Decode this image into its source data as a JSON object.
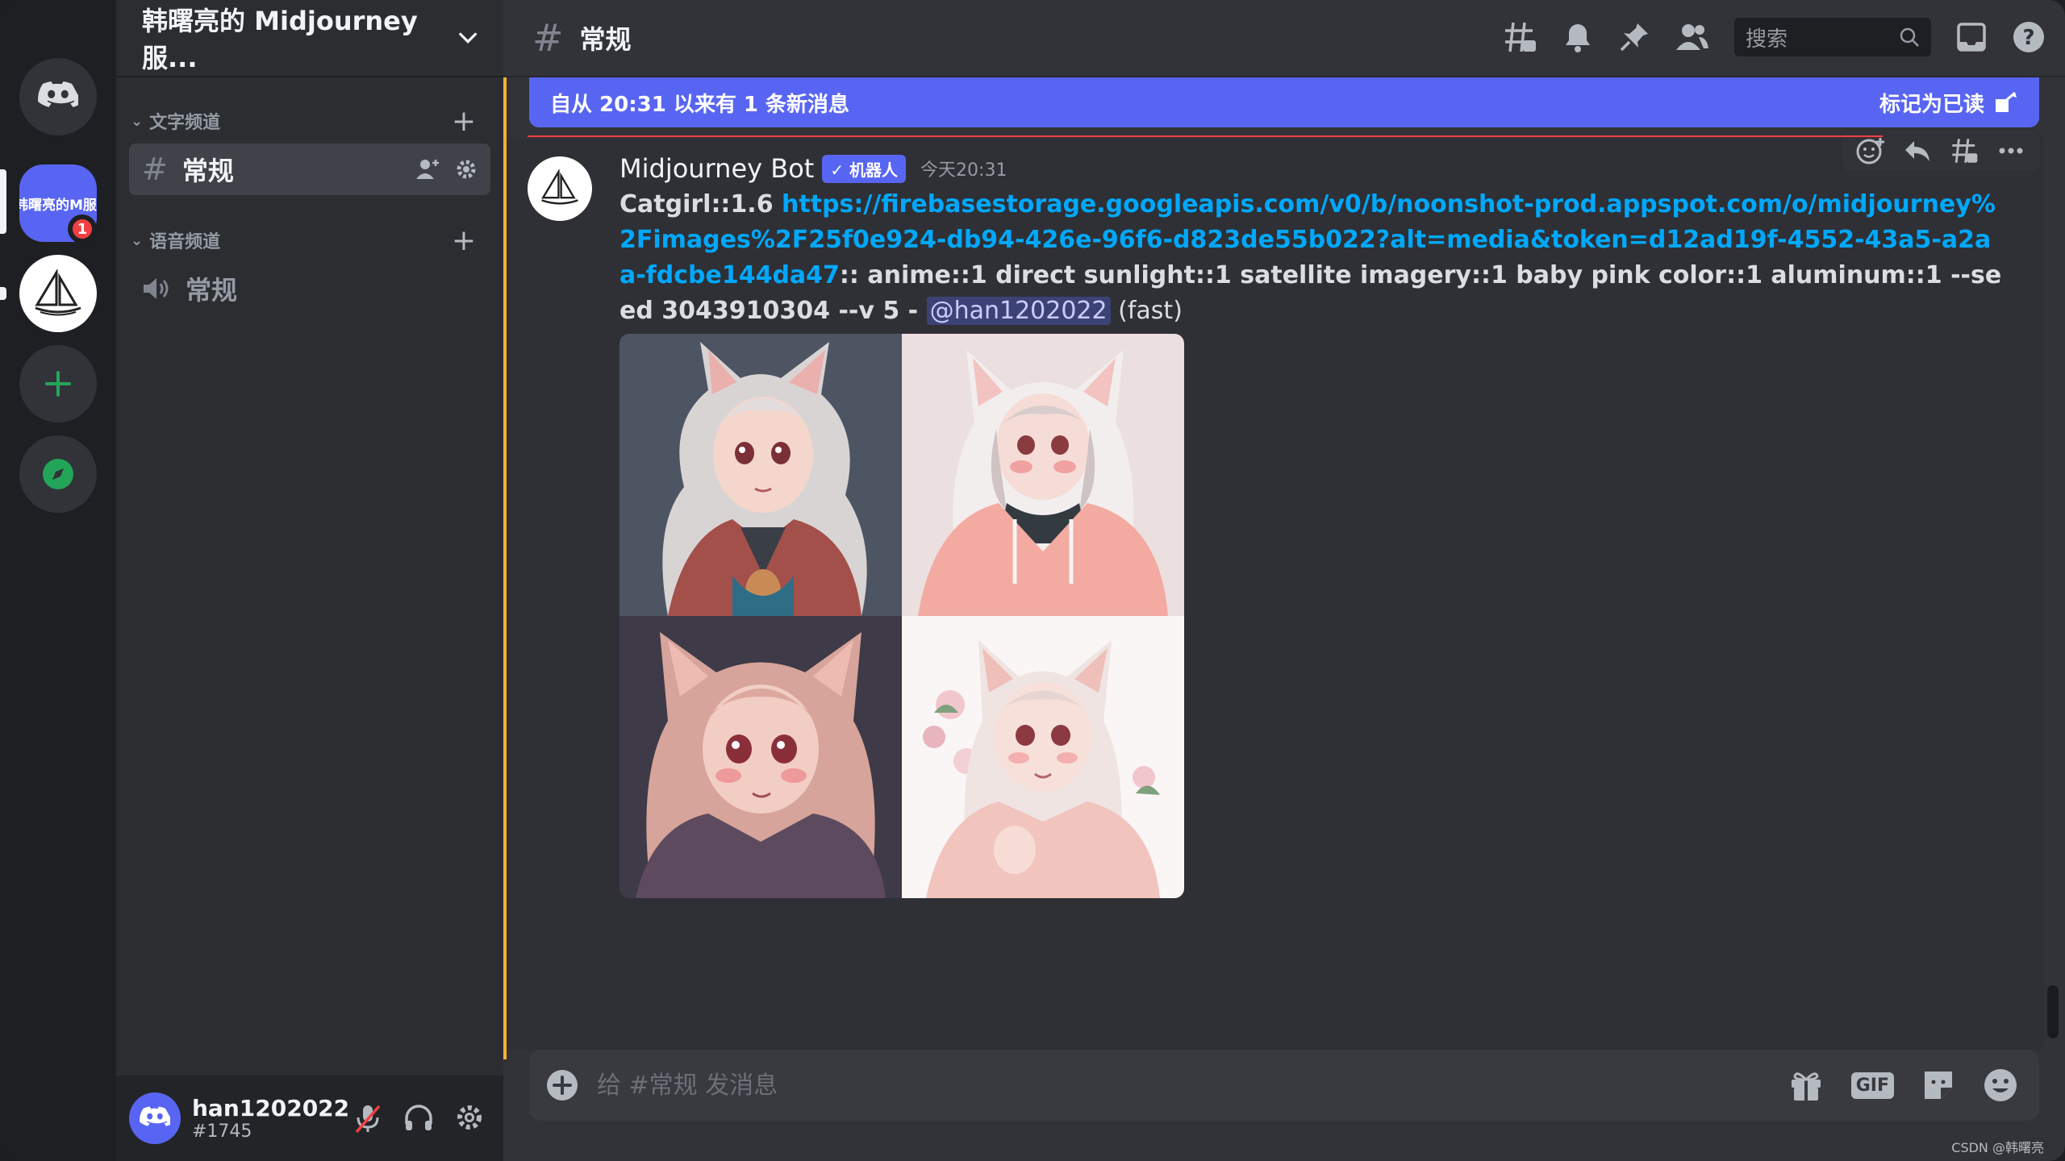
{
  "rail": {
    "server1_label": "韩曙亮的M服务",
    "server1_badge": "1"
  },
  "sidebar": {
    "guild_title": "韩曙亮的 Midjourney 服...",
    "text_category": "文字频道",
    "voice_category": "语音频道",
    "text_channel": "常规",
    "voice_channel": "常规"
  },
  "user": {
    "name": "han1202022",
    "tag": "#1745"
  },
  "topbar": {
    "channel_name": "常规",
    "search_placeholder": "搜索"
  },
  "new_messages": {
    "text": "自从 20:31 以来有 1 条新消息",
    "mark_read": "标记为已读"
  },
  "message": {
    "author": "Midjourney Bot",
    "bot_tag": "✓ 机器人",
    "time": "今天20:31",
    "prompt_prefix": "Catgirl::1.6 ",
    "link": "https://firebasestorage.googleapis.com/v0/b/noonshot-prod.appspot.com/o/midjourney%2Fimages%2F25f0e924-db94-426e-96f6-d823de55b022?alt=media&token=d12ad19f-4552-43a5-a2aa-fdcbe144da47",
    "prompt_suffix": ":: anime::1 direct sunlight::1 satellite imagery::1 baby pink color::1 aluminum::1 --seed 3043910304 --v 5 - ",
    "mention": "@han1202022",
    "speed": " (fast)"
  },
  "composer": {
    "placeholder": "给 #常规 发消息",
    "gif_label": "GIF"
  },
  "watermark": "CSDN @韩曙亮",
  "colors": {
    "blurple": "#5865f2",
    "link": "#00a8fc",
    "highlight": "#f0b232",
    "danger": "#f23f43"
  }
}
